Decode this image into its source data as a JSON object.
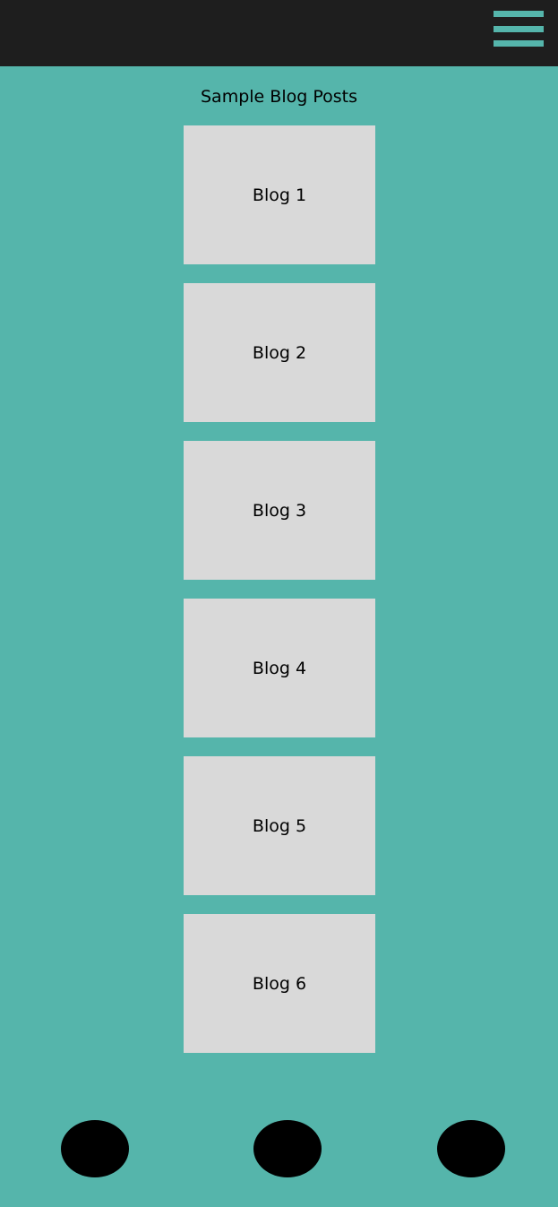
{
  "header": {
    "menu_icon": "hamburger-menu-icon"
  },
  "main": {
    "title": "Sample Blog Posts",
    "posts": [
      {
        "label": "Blog 1"
      },
      {
        "label": "Blog 2"
      },
      {
        "label": "Blog 3"
      },
      {
        "label": "Blog 4"
      },
      {
        "label": "Blog 5"
      },
      {
        "label": "Blog 6"
      }
    ]
  },
  "bottom_nav": {
    "buttons": 3
  },
  "colors": {
    "background": "#55b5ab",
    "header": "#1e1e1e",
    "card": "#d9d9d9",
    "nav_button": "#000000"
  }
}
